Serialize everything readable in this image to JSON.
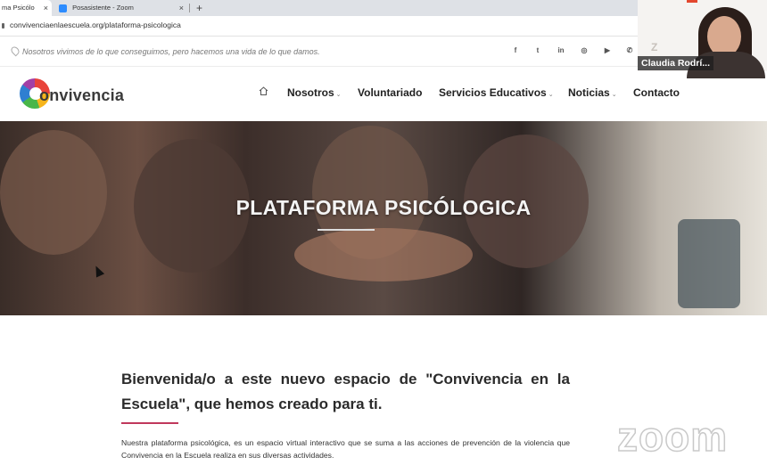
{
  "browser": {
    "tabs": [
      {
        "label": "ma Psicólo"
      },
      {
        "label": "Posasistente - Zoom"
      }
    ],
    "new_tab": "+",
    "close_glyph": "×",
    "url": "convivenciaenlaescuela.org/plataforma-psicologica"
  },
  "site": {
    "slogan": "Nosotros vivimos de lo que conseguimos, pero hacemos una vida de lo que damos.",
    "social": [
      {
        "glyph": "f",
        "icon": "facebook-icon"
      },
      {
        "glyph": "t",
        "icon": "twitter-icon"
      },
      {
        "glyph": "in",
        "icon": "linkedin-icon"
      },
      {
        "glyph": "◎",
        "icon": "instagram-icon"
      },
      {
        "glyph": "▶",
        "icon": "youtube-icon"
      },
      {
        "glyph": "✆",
        "icon": "whatsapp-icon"
      }
    ],
    "logo_text": "onvivencia",
    "nav": {
      "home_icon": "home-icon",
      "items": [
        {
          "label": "Nosotros",
          "dropdown": "⌄"
        },
        {
          "label": "Voluntariado"
        },
        {
          "label": "Servicios Educativos",
          "dropdown": "⌄"
        },
        {
          "label": "Noticias",
          "dropdown": "⌄"
        },
        {
          "label": "Contacto"
        }
      ]
    },
    "hero_title": "PLATAFORMA PSICÓLOGICA",
    "welcome": "Bienvenida/o a este nuevo espacio de \"Convivencia en la Escuela\", que hemos creado para ti.",
    "paragraph": "Nuestra plataforma psicológica, es un espacio virtual interactivo que se suma a las acciones de prevención de la violencia que Convivencia en la Escuela realiza en sus diversas actividades.",
    "accent_color": "#c0385c"
  },
  "zoom": {
    "participant_name": "Claudia Rodrí...",
    "watermark": "zoom",
    "corner_mark": "Z"
  }
}
